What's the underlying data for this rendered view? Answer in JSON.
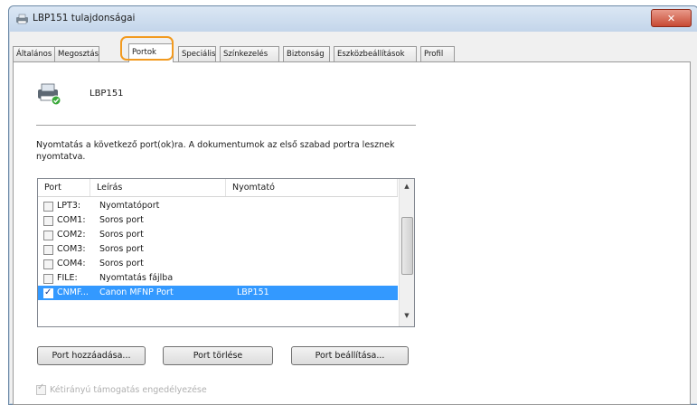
{
  "window": {
    "title": "LBP151 tulajdonságai",
    "close_label": "✕"
  },
  "tabs": [
    {
      "label": "Általános",
      "active": false
    },
    {
      "label": "Megosztás",
      "active": false
    },
    {
      "label": "Portok",
      "active": true
    },
    {
      "label": "Speciális",
      "active": false
    },
    {
      "label": "Színkezelés",
      "active": false
    },
    {
      "label": "Biztonság",
      "active": false
    },
    {
      "label": "Eszközbeállítások",
      "active": false
    },
    {
      "label": "Profil",
      "active": false
    }
  ],
  "printer": {
    "name": "LBP151",
    "icon": "printer-icon"
  },
  "description": "Nyomtatás a következő port(ok)ra. A dokumentumok az első szabad portra lesznek nyomtatva.",
  "port_list": {
    "columns": [
      "Port",
      "Leírás",
      "Nyomtató"
    ],
    "rows": [
      {
        "port": "LPT3:",
        "desc": "Nyomtatóport",
        "printer": "",
        "checked": false,
        "selected": false
      },
      {
        "port": "COM1:",
        "desc": "Soros port",
        "printer": "",
        "checked": false,
        "selected": false
      },
      {
        "port": "COM2:",
        "desc": "Soros port",
        "printer": "",
        "checked": false,
        "selected": false
      },
      {
        "port": "COM3:",
        "desc": "Soros port",
        "printer": "",
        "checked": false,
        "selected": false
      },
      {
        "port": "COM4:",
        "desc": "Soros port",
        "printer": "",
        "checked": false,
        "selected": false
      },
      {
        "port": "FILE:",
        "desc": "Nyomtatás fájlba",
        "printer": "",
        "checked": false,
        "selected": false
      },
      {
        "port": "CNMF...",
        "desc": "Canon MFNP Port",
        "printer": "LBP151",
        "checked": true,
        "selected": true
      }
    ],
    "scroll_up": "▲",
    "scroll_down": "▼",
    "check_mark": "✓"
  },
  "buttons": {
    "add_port": "Port hozzáadása...",
    "delete_port": "Port törlése",
    "configure_port": "Port beállítása..."
  },
  "bidi_support": {
    "label": "Kétirányú támogatás engedélyezése",
    "checked": true,
    "disabled": true
  },
  "colors": {
    "selection": "#3399ff",
    "highlight_ring": "#f29a1f",
    "close_button": "#c74a34"
  }
}
